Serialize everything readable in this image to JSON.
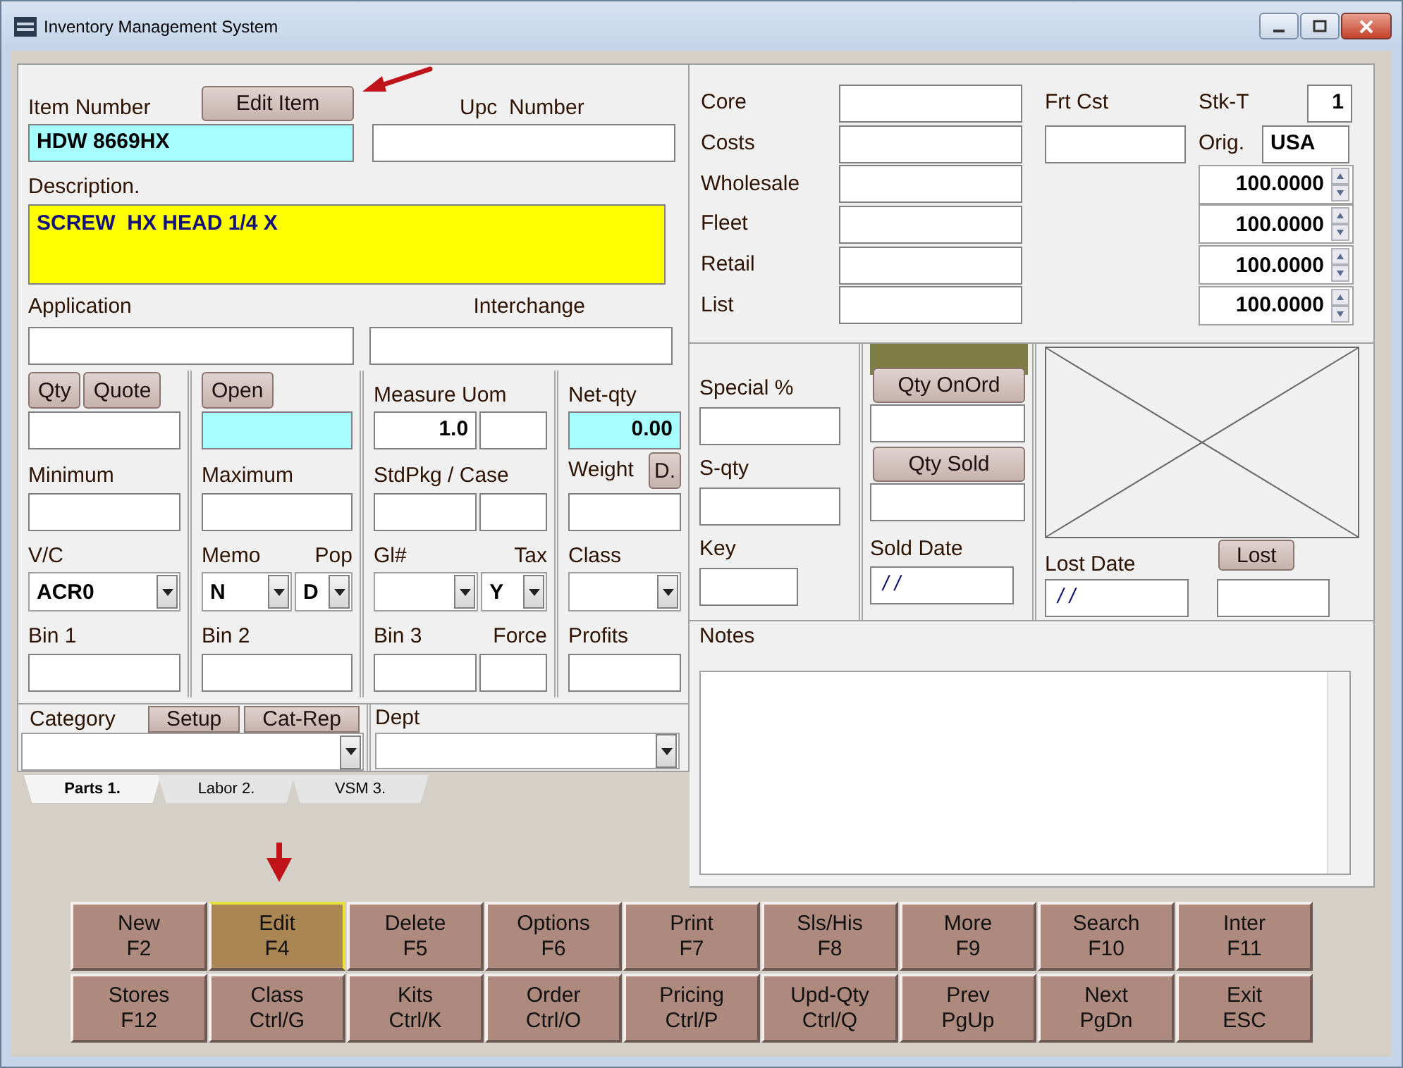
{
  "window": {
    "title": "Inventory Management System"
  },
  "item": {
    "item_number_label": "Item Number",
    "edit_button": "Edit Item",
    "upc_label": "Upc  Number",
    "item_number": "HDW 8669HX",
    "description_label": "Description.",
    "description": "SCREW  HX HEAD 1/4 X",
    "application_label": "Application",
    "interchange_label": "Interchange"
  },
  "item_grid": {
    "columns": [
      [
        {
          "kind": "buttons",
          "items": [
            "Qty",
            "Quote"
          ]
        },
        {
          "kind": "fields",
          "items": [
            {
              "highlighted": false
            }
          ]
        },
        {
          "kind": "labels",
          "items": [
            "Minimum"
          ]
        },
        {
          "kind": "fields",
          "items": [
            {
              "highlighted": false
            }
          ]
        },
        {
          "kind": "labels",
          "items": [
            "V/C"
          ]
        },
        {
          "kind": "combos",
          "items": [
            {
              "kind": "filled",
              "value": "ACR0"
            }
          ]
        },
        {
          "kind": "labels",
          "items": [
            "Bin 1"
          ]
        },
        {
          "kind": "fields",
          "items": [
            {
              "highlighted": false
            }
          ]
        }
      ],
      [
        {
          "kind": "buttons",
          "items": [
            "Open"
          ]
        },
        {
          "kind": "fields",
          "items": [
            {
              "highlighted": true
            }
          ]
        },
        {
          "kind": "labels",
          "items": [
            "Maximum"
          ]
        },
        {
          "kind": "fields",
          "items": [
            {
              "highlighted": false
            }
          ]
        },
        {
          "kind": "labels",
          "items": [
            "Memo",
            "Pop"
          ]
        },
        {
          "kind": "combos",
          "items": [
            {
              "kind": "filled",
              "value": "N"
            },
            {
              "kind": "filled",
              "value": "D"
            }
          ]
        },
        {
          "kind": "labels",
          "items": [
            "Bin 2"
          ]
        },
        {
          "kind": "fields",
          "items": [
            {
              "highlighted": false
            }
          ]
        }
      ],
      [
        {
          "kind": "labels",
          "items": [
            "Measure Uom"
          ]
        },
        {
          "kind": "fields",
          "items": [
            {
              "value": "1.0",
              "highlighted": false
            },
            {
              "highlighted": false
            }
          ]
        },
        {
          "kind": "labels",
          "items": [
            "StdPkg / Case"
          ]
        },
        {
          "kind": "fields",
          "items": [
            {
              "highlighted": false
            },
            {
              "highlighted": false
            }
          ]
        },
        {
          "kind": "labels",
          "items": [
            "Gl#",
            "Tax"
          ]
        },
        {
          "kind": "combos",
          "items": [
            {
              "kind": "blank"
            },
            {
              "kind": "filled",
              "value": "Y"
            }
          ]
        },
        {
          "kind": "labels",
          "items": [
            "Bin 3",
            "Force"
          ]
        },
        {
          "kind": "fields",
          "items": [
            {
              "highlighted": false
            },
            {
              "highlighted": false
            }
          ]
        }
      ],
      [
        {
          "kind": "labels",
          "items": [
            "Net-qty"
          ]
        },
        {
          "kind": "fields",
          "items": [
            {
              "value": "0.00",
              "highlighted": true
            }
          ]
        },
        {
          "kind": "label_button",
          "items": [
            "Weight",
            "D."
          ]
        },
        {
          "kind": "fields",
          "items": [
            {
              "highlighted": false
            }
          ]
        },
        {
          "kind": "labels",
          "items": [
            "Class"
          ]
        },
        {
          "kind": "combos",
          "items": [
            {
              "kind": "blank"
            }
          ]
        },
        {
          "kind": "labels",
          "items": [
            "Profits"
          ]
        },
        {
          "kind": "fields",
          "items": [
            {
              "highlighted": false
            }
          ]
        }
      ]
    ]
  },
  "category": {
    "label": "Category",
    "setup_button": "Setup",
    "cat_rep_button": "Cat-Rep",
    "dept_label": "Dept"
  },
  "tabs": [
    {
      "label": "Parts 1.",
      "selected": true
    },
    {
      "label": "Labor 2.",
      "selected": false
    },
    {
      "label": "VSM 3.",
      "selected": false
    }
  ],
  "pricing": {
    "rows": [
      "Core",
      "Costs",
      "Wholesale",
      "Fleet",
      "Retail",
      "List"
    ],
    "freight_label": "Frt Cst",
    "stock_type_label": "Stk-T",
    "stock_type": "1",
    "origin_label": "Orig.",
    "origin": "USA",
    "percentages": [
      "100.0000",
      "100.0000",
      "100.0000",
      "100.0000"
    ]
  },
  "stats": {
    "special_label": "Special %",
    "s_qty_label": "S-qty",
    "key_label": "Key",
    "qty_on_order_button": "Qty OnOrd",
    "qty_sold_button": "Qty Sold",
    "sold_date_label": "Sold Date",
    "sold_date": "/ /",
    "lost_date_label": "Lost Date",
    "lost_date": "/ /",
    "lost_button": "Lost"
  },
  "notes": {
    "label": "Notes"
  },
  "function_keys": [
    {
      "label": "New",
      "key": "F2",
      "selected": false
    },
    {
      "label": "Edit",
      "key": "F4",
      "selected": true
    },
    {
      "label": "Delete",
      "key": "F5",
      "selected": false
    },
    {
      "label": "Options",
      "key": "F6",
      "selected": false
    },
    {
      "label": "Print",
      "key": "F7",
      "selected": false
    },
    {
      "label": "Sls/His",
      "key": "F8",
      "selected": false
    },
    {
      "label": "More",
      "key": "F9",
      "selected": false
    },
    {
      "label": "Search",
      "key": "F10",
      "selected": false
    },
    {
      "label": "Inter",
      "key": "F11",
      "selected": false
    },
    {
      "label": "Stores",
      "key": "F12",
      "selected": false
    },
    {
      "label": "Class",
      "key": "Ctrl/G",
      "selected": false
    },
    {
      "label": "Kits",
      "key": "Ctrl/K",
      "selected": false
    },
    {
      "label": "Order",
      "key": "Ctrl/O",
      "selected": false
    },
    {
      "label": "Pricing",
      "key": "Ctrl/P",
      "selected": false
    },
    {
      "label": "Upd-Qty",
      "key": "Ctrl/Q",
      "selected": false
    },
    {
      "label": "Prev",
      "key": "PgUp",
      "selected": false
    },
    {
      "label": "Next",
      "key": "PgDn",
      "selected": false
    },
    {
      "label": "Exit",
      "key": "ESC",
      "selected": false
    }
  ]
}
